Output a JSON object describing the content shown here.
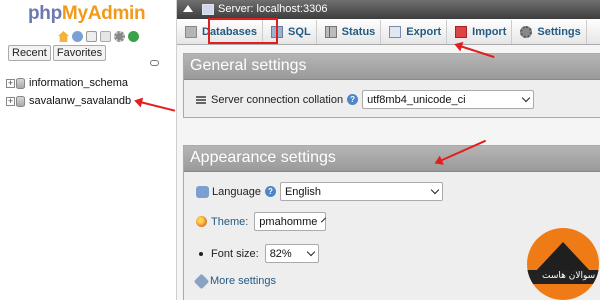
{
  "navigation": {
    "logo_part1": "php",
    "logo_part2": "MyAdmin",
    "icons": [
      "home-icon",
      "exit-icon",
      "docs-icon",
      "sql-docs-icon",
      "settings-icon",
      "reload-icon"
    ],
    "tabs": [
      "Recent",
      "Favorites"
    ],
    "databases": [
      "information_schema",
      "savalanw_savalandb"
    ]
  },
  "topbar": {
    "server_label": "Server: localhost:3306"
  },
  "tabs": [
    {
      "label": "Databases",
      "icon": "database-icon"
    },
    {
      "label": "SQL",
      "icon": "sql-icon"
    },
    {
      "label": "Status",
      "icon": "status-icon"
    },
    {
      "label": "Export",
      "icon": "export-icon"
    },
    {
      "label": "Import",
      "icon": "import-icon"
    },
    {
      "label": "Settings",
      "icon": "settings-icon"
    }
  ],
  "general_settings": {
    "title": "General settings",
    "collation_label": "Server connection collation",
    "collation_value": "utf8mb4_unicode_ci"
  },
  "appearance_settings": {
    "title": "Appearance settings",
    "language_label": "Language",
    "language_value": "English",
    "theme_label": "Theme:",
    "theme_value": "pmahomme",
    "font_size_label": "Font size:",
    "font_size_value": "82%",
    "more_settings": "More settings"
  },
  "annotations": {
    "highlight_color": "#e21f1f",
    "watermark_text": "سوالان هاست"
  }
}
